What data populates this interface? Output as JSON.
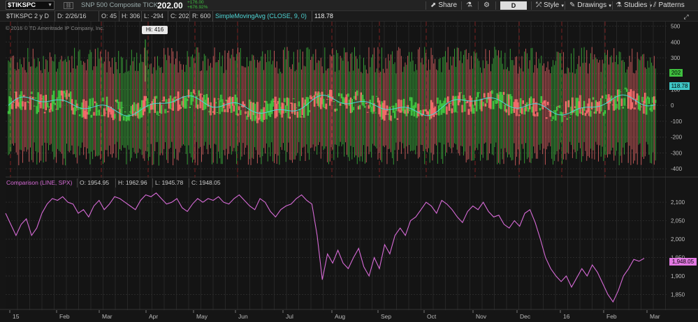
{
  "toolbar": {
    "symbol": "$TIKSPC",
    "description": "SNP 500 Composite TICK",
    "last_price": "202.00",
    "net_change": "+176.00",
    "percent_change": "+676.92%",
    "share_label": "Share",
    "period": "D",
    "style_label": "Style",
    "drawings_label": "Drawings",
    "studies_label": "Studies",
    "patterns_label": "Patterns"
  },
  "header": {
    "chart_name": "$TIKSPC 2 y D",
    "date": "D: 2/26/16",
    "open": "O: 45",
    "high": "H: 306",
    "low": "L: -294",
    "close": "C: 202",
    "range": "R: 600",
    "sma_label": "SimpleMovingAvg (CLOSE, 9, 0)",
    "sma_value": "118.78"
  },
  "watermark": "© 2016 © TD Ameritrade IP Company, Inc.",
  "hi_label": "Hi: 416",
  "tags": {
    "last": "202",
    "sma": "118.78",
    "comparison": "1,948.05"
  },
  "comparison": {
    "label": "Comparison (LINE, SPX)",
    "open": "O: 1954.95",
    "high": "H: 1962.96",
    "low": "L: 1945.78",
    "close": "C: 1948.05"
  },
  "colors": {
    "up": "#3fbf3f",
    "down": "#f06a6a",
    "sma": "#4fd6d6",
    "comparison": "#d66ad6",
    "grid_red": "#7a1f1f"
  },
  "icons": [
    "share-icon",
    "flask-icon",
    "gear-icon",
    "style-icon",
    "pencil-icon",
    "studies-icon",
    "patterns-icon",
    "zoom-icon"
  ],
  "chart_data": [
    {
      "type": "candlestick",
      "title": "$TIKSPC 2 y D",
      "y_ticks": [
        500,
        400,
        300,
        200,
        100,
        0,
        -100,
        -200,
        -300,
        -400
      ],
      "ylim": [
        -430,
        520
      ],
      "x_months": [
        "15",
        "Feb",
        "Mar",
        "Apr",
        "May",
        "Jun",
        "Jul",
        "Aug",
        "Sep",
        "Oct",
        "Nov",
        "Dec",
        "16",
        "Feb",
        "Mar"
      ],
      "series": [
        {
          "name": "SimpleMovingAvg (CLOSE, 9, 0)",
          "last": 118.78
        }
      ],
      "hi": 416,
      "last": 202
    },
    {
      "type": "line",
      "title": "Comparison (LINE, SPX)",
      "y_ticks": [
        2100,
        2050,
        2000,
        1950,
        1900,
        1850
      ],
      "ylim": [
        1815,
        2140
      ],
      "x_months": [
        "15",
        "Feb",
        "Mar",
        "Apr",
        "May",
        "Jun",
        "Jul",
        "Aug",
        "Sep",
        "Oct",
        "Nov",
        "Dec",
        "16",
        "Feb",
        "Mar"
      ],
      "points": [
        [
          0,
          2070
        ],
        [
          4,
          2040
        ],
        [
          8,
          2010
        ],
        [
          12,
          2040
        ],
        [
          16,
          2055
        ],
        [
          20,
          2010
        ],
        [
          24,
          2030
        ],
        [
          28,
          2070
        ],
        [
          32,
          2095
        ],
        [
          36,
          2110
        ],
        [
          40,
          2105
        ],
        [
          44,
          2115
        ],
        [
          48,
          2100
        ],
        [
          52,
          2095
        ],
        [
          56,
          2070
        ],
        [
          60,
          2080
        ],
        [
          64,
          2060
        ],
        [
          68,
          2090
        ],
        [
          72,
          2105
        ],
        [
          76,
          2080
        ],
        [
          80,
          2095
        ],
        [
          84,
          2115
        ],
        [
          88,
          2110
        ],
        [
          92,
          2100
        ],
        [
          96,
          2090
        ],
        [
          100,
          2080
        ],
        [
          104,
          2105
        ],
        [
          108,
          2120
        ],
        [
          112,
          2115
        ],
        [
          116,
          2125
        ],
        [
          120,
          2110
        ],
        [
          124,
          2095
        ],
        [
          128,
          2100
        ],
        [
          132,
          2110
        ],
        [
          136,
          2085
        ],
        [
          140,
          2075
        ],
        [
          144,
          2095
        ],
        [
          148,
          2110
        ],
        [
          152,
          2100
        ],
        [
          156,
          2110
        ],
        [
          160,
          2105
        ],
        [
          164,
          2115
        ],
        [
          168,
          2100
        ],
        [
          172,
          2095
        ],
        [
          176,
          2110
        ],
        [
          180,
          2120
        ],
        [
          184,
          2105
        ],
        [
          188,
          2090
        ],
        [
          192,
          2080
        ],
        [
          196,
          2110
        ],
        [
          200,
          2100
        ],
        [
          204,
          2075
        ],
        [
          208,
          2060
        ],
        [
          212,
          2080
        ],
        [
          216,
          2090
        ],
        [
          220,
          2095
        ],
        [
          224,
          2110
        ],
        [
          228,
          2120
        ],
        [
          232,
          2105
        ],
        [
          236,
          2095
        ],
        [
          240,
          2010
        ],
        [
          244,
          1890
        ],
        [
          248,
          1960
        ],
        [
          252,
          1935
        ],
        [
          256,
          1970
        ],
        [
          260,
          1935
        ],
        [
          264,
          1920
        ],
        [
          268,
          1950
        ],
        [
          272,
          1975
        ],
        [
          276,
          1925
        ],
        [
          280,
          1900
        ],
        [
          284,
          1950
        ],
        [
          288,
          1920
        ],
        [
          292,
          1985
        ],
        [
          296,
          1960
        ],
        [
          300,
          2010
        ],
        [
          304,
          2030
        ],
        [
          308,
          2010
        ],
        [
          312,
          2050
        ],
        [
          316,
          2060
        ],
        [
          320,
          2080
        ],
        [
          324,
          2100
        ],
        [
          328,
          2090
        ],
        [
          332,
          2070
        ],
        [
          336,
          2105
        ],
        [
          340,
          2095
        ],
        [
          344,
          2080
        ],
        [
          348,
          2060
        ],
        [
          352,
          2045
        ],
        [
          356,
          2075
        ],
        [
          360,
          2090
        ],
        [
          364,
          2080
        ],
        [
          368,
          2100
        ],
        [
          372,
          2075
        ],
        [
          376,
          2060
        ],
        [
          380,
          2065
        ],
        [
          384,
          2040
        ],
        [
          388,
          2030
        ],
        [
          392,
          2050
        ],
        [
          396,
          2035
        ],
        [
          400,
          2070
        ],
        [
          404,
          2080
        ],
        [
          408,
          2045
        ],
        [
          412,
          2000
        ],
        [
          416,
          1950
        ],
        [
          420,
          1920
        ],
        [
          424,
          1900
        ],
        [
          428,
          1885
        ],
        [
          432,
          1900
        ],
        [
          436,
          1870
        ],
        [
          440,
          1895
        ],
        [
          444,
          1920
        ],
        [
          448,
          1900
        ],
        [
          452,
          1930
        ],
        [
          456,
          1910
        ],
        [
          460,
          1880
        ],
        [
          464,
          1850
        ],
        [
          468,
          1830
        ],
        [
          472,
          1860
        ],
        [
          476,
          1900
        ],
        [
          480,
          1920
        ],
        [
          484,
          1945
        ],
        [
          488,
          1940
        ],
        [
          492,
          1948
        ]
      ],
      "last": 1948.05
    }
  ]
}
